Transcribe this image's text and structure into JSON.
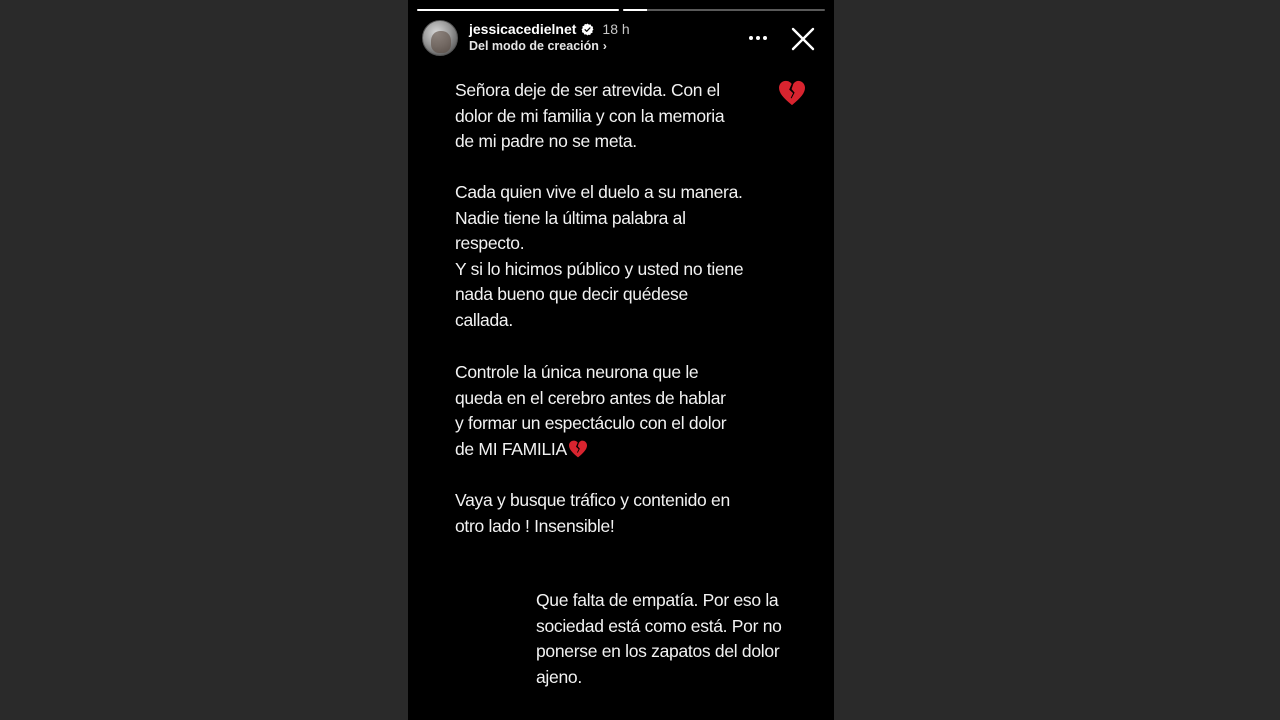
{
  "story": {
    "progress_segments": [
      1.0,
      0.12
    ],
    "user": {
      "username": "jessicacedielnet",
      "time_ago": "18 h",
      "subtitle": "Del modo de creación",
      "verified": true
    },
    "icons": {
      "verified": "verified-badge-icon",
      "more": "more-options-icon",
      "close": "close-icon",
      "heart": "broken-heart-emoji"
    },
    "colors": {
      "background": "#000000",
      "heart": "#e0303a",
      "verified": "#3897f0"
    },
    "paragraph1": [
      "Señora deje de ser atrevida. Con el",
      "dolor de mi familia y con la memoria",
      "de mi padre no se meta."
    ],
    "paragraph2": [
      "Cada quien vive el duelo a su manera.",
      "Nadie tiene la última palabra al",
      "respecto.",
      "Y si lo hicimos público y usted no tiene",
      "nada bueno que decir quédese",
      "callada."
    ],
    "paragraph3": [
      "Controle la única neurona que le",
      "queda en el cerebro antes de hablar",
      "y formar un espectáculo con el dolor",
      "de MI FAMILIA"
    ],
    "paragraph4": [
      "Vaya y busque tráfico y contenido en",
      "otro lado ! Insensible!"
    ],
    "paragraph5": [
      "Que falta de empatía. Por eso la",
      "sociedad está como está. Por no",
      "ponerse en los zapatos del dolor",
      "ajeno."
    ]
  }
}
